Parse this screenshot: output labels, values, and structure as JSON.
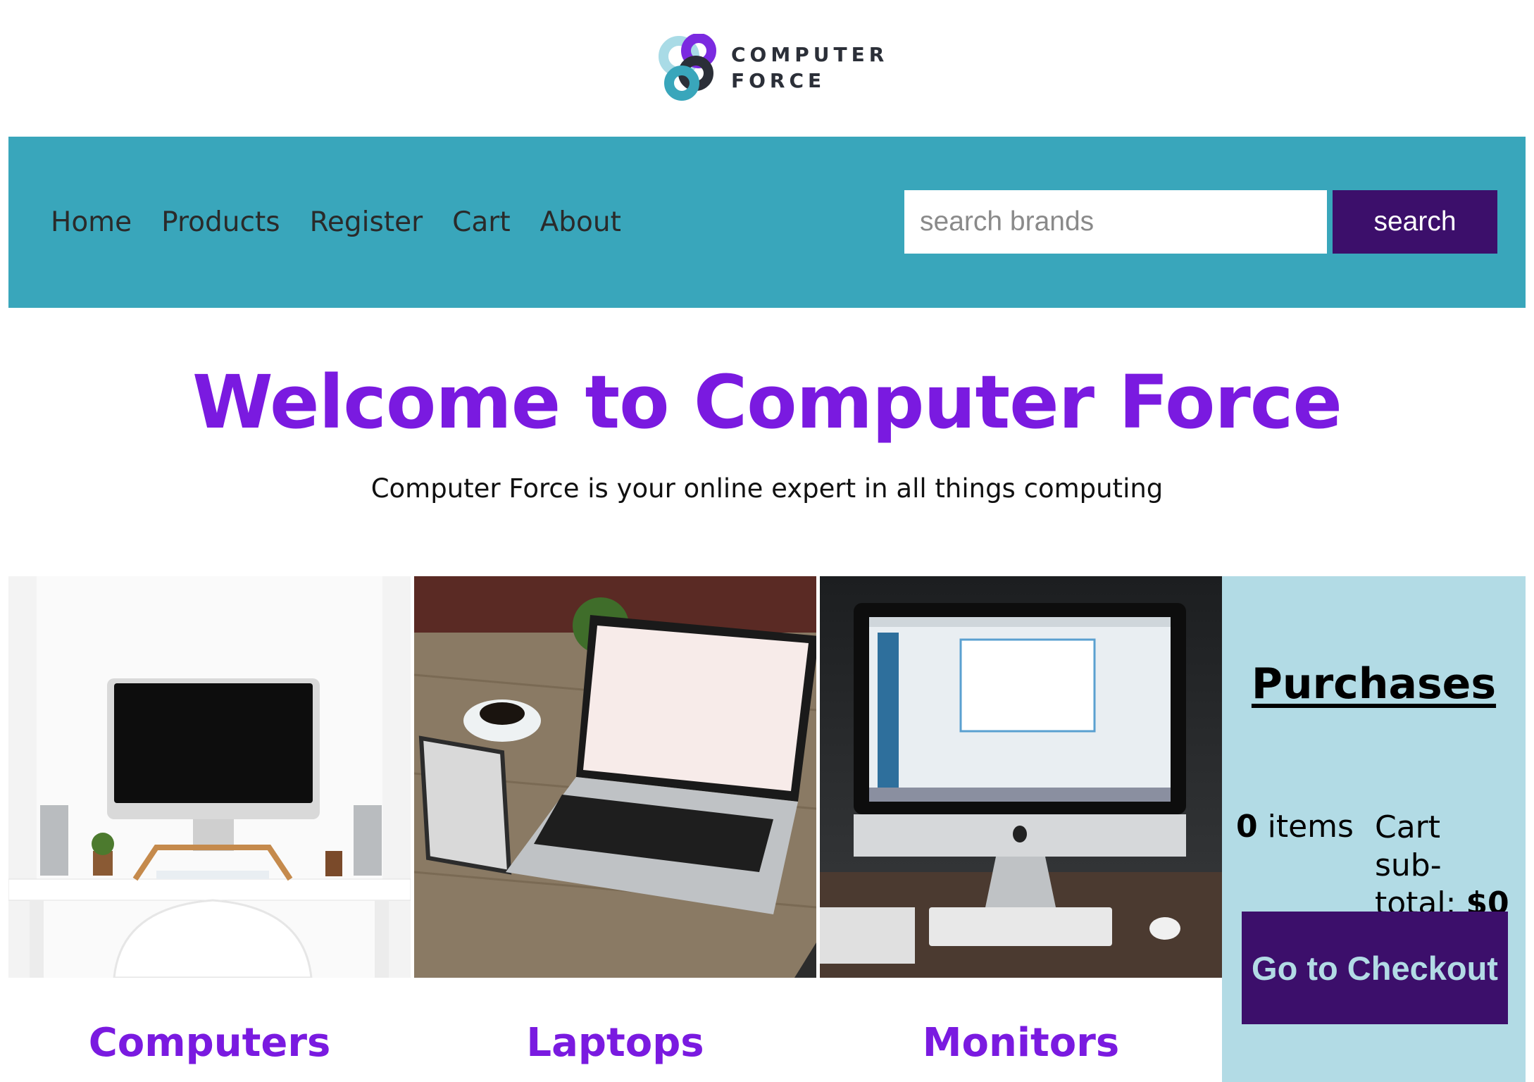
{
  "brand": {
    "line1": "COMPUTER",
    "line2": "FORCE",
    "logo_icon": "infinity-knot-icon",
    "colors": {
      "purple": "#7b2ae0",
      "teal": "#39a6bb",
      "dark": "#2b2f38",
      "light_blue": "#a9dbe6"
    }
  },
  "nav": {
    "links": [
      "Home",
      "Products",
      "Register",
      "Cart",
      "About"
    ],
    "search_placeholder": "search brands",
    "search_value": "",
    "search_button": "search",
    "background": "#39a6bb"
  },
  "hero": {
    "title": "Welcome to Computer Force",
    "subtitle": "Computer Force is your online expert in all things computing"
  },
  "categories": [
    {
      "label": "Computers",
      "image": "desk-computer-photo"
    },
    {
      "label": "Laptops",
      "image": "laptop-on-table-photo"
    },
    {
      "label": "Monitors",
      "image": "imac-monitor-photo"
    }
  ],
  "cart": {
    "title": "Purchases",
    "item_count": "0",
    "items_label": "items",
    "subtotal_label": "Cart sub-total:",
    "subtotal_value": "$0",
    "checkout_button": "Go to Checkout"
  }
}
